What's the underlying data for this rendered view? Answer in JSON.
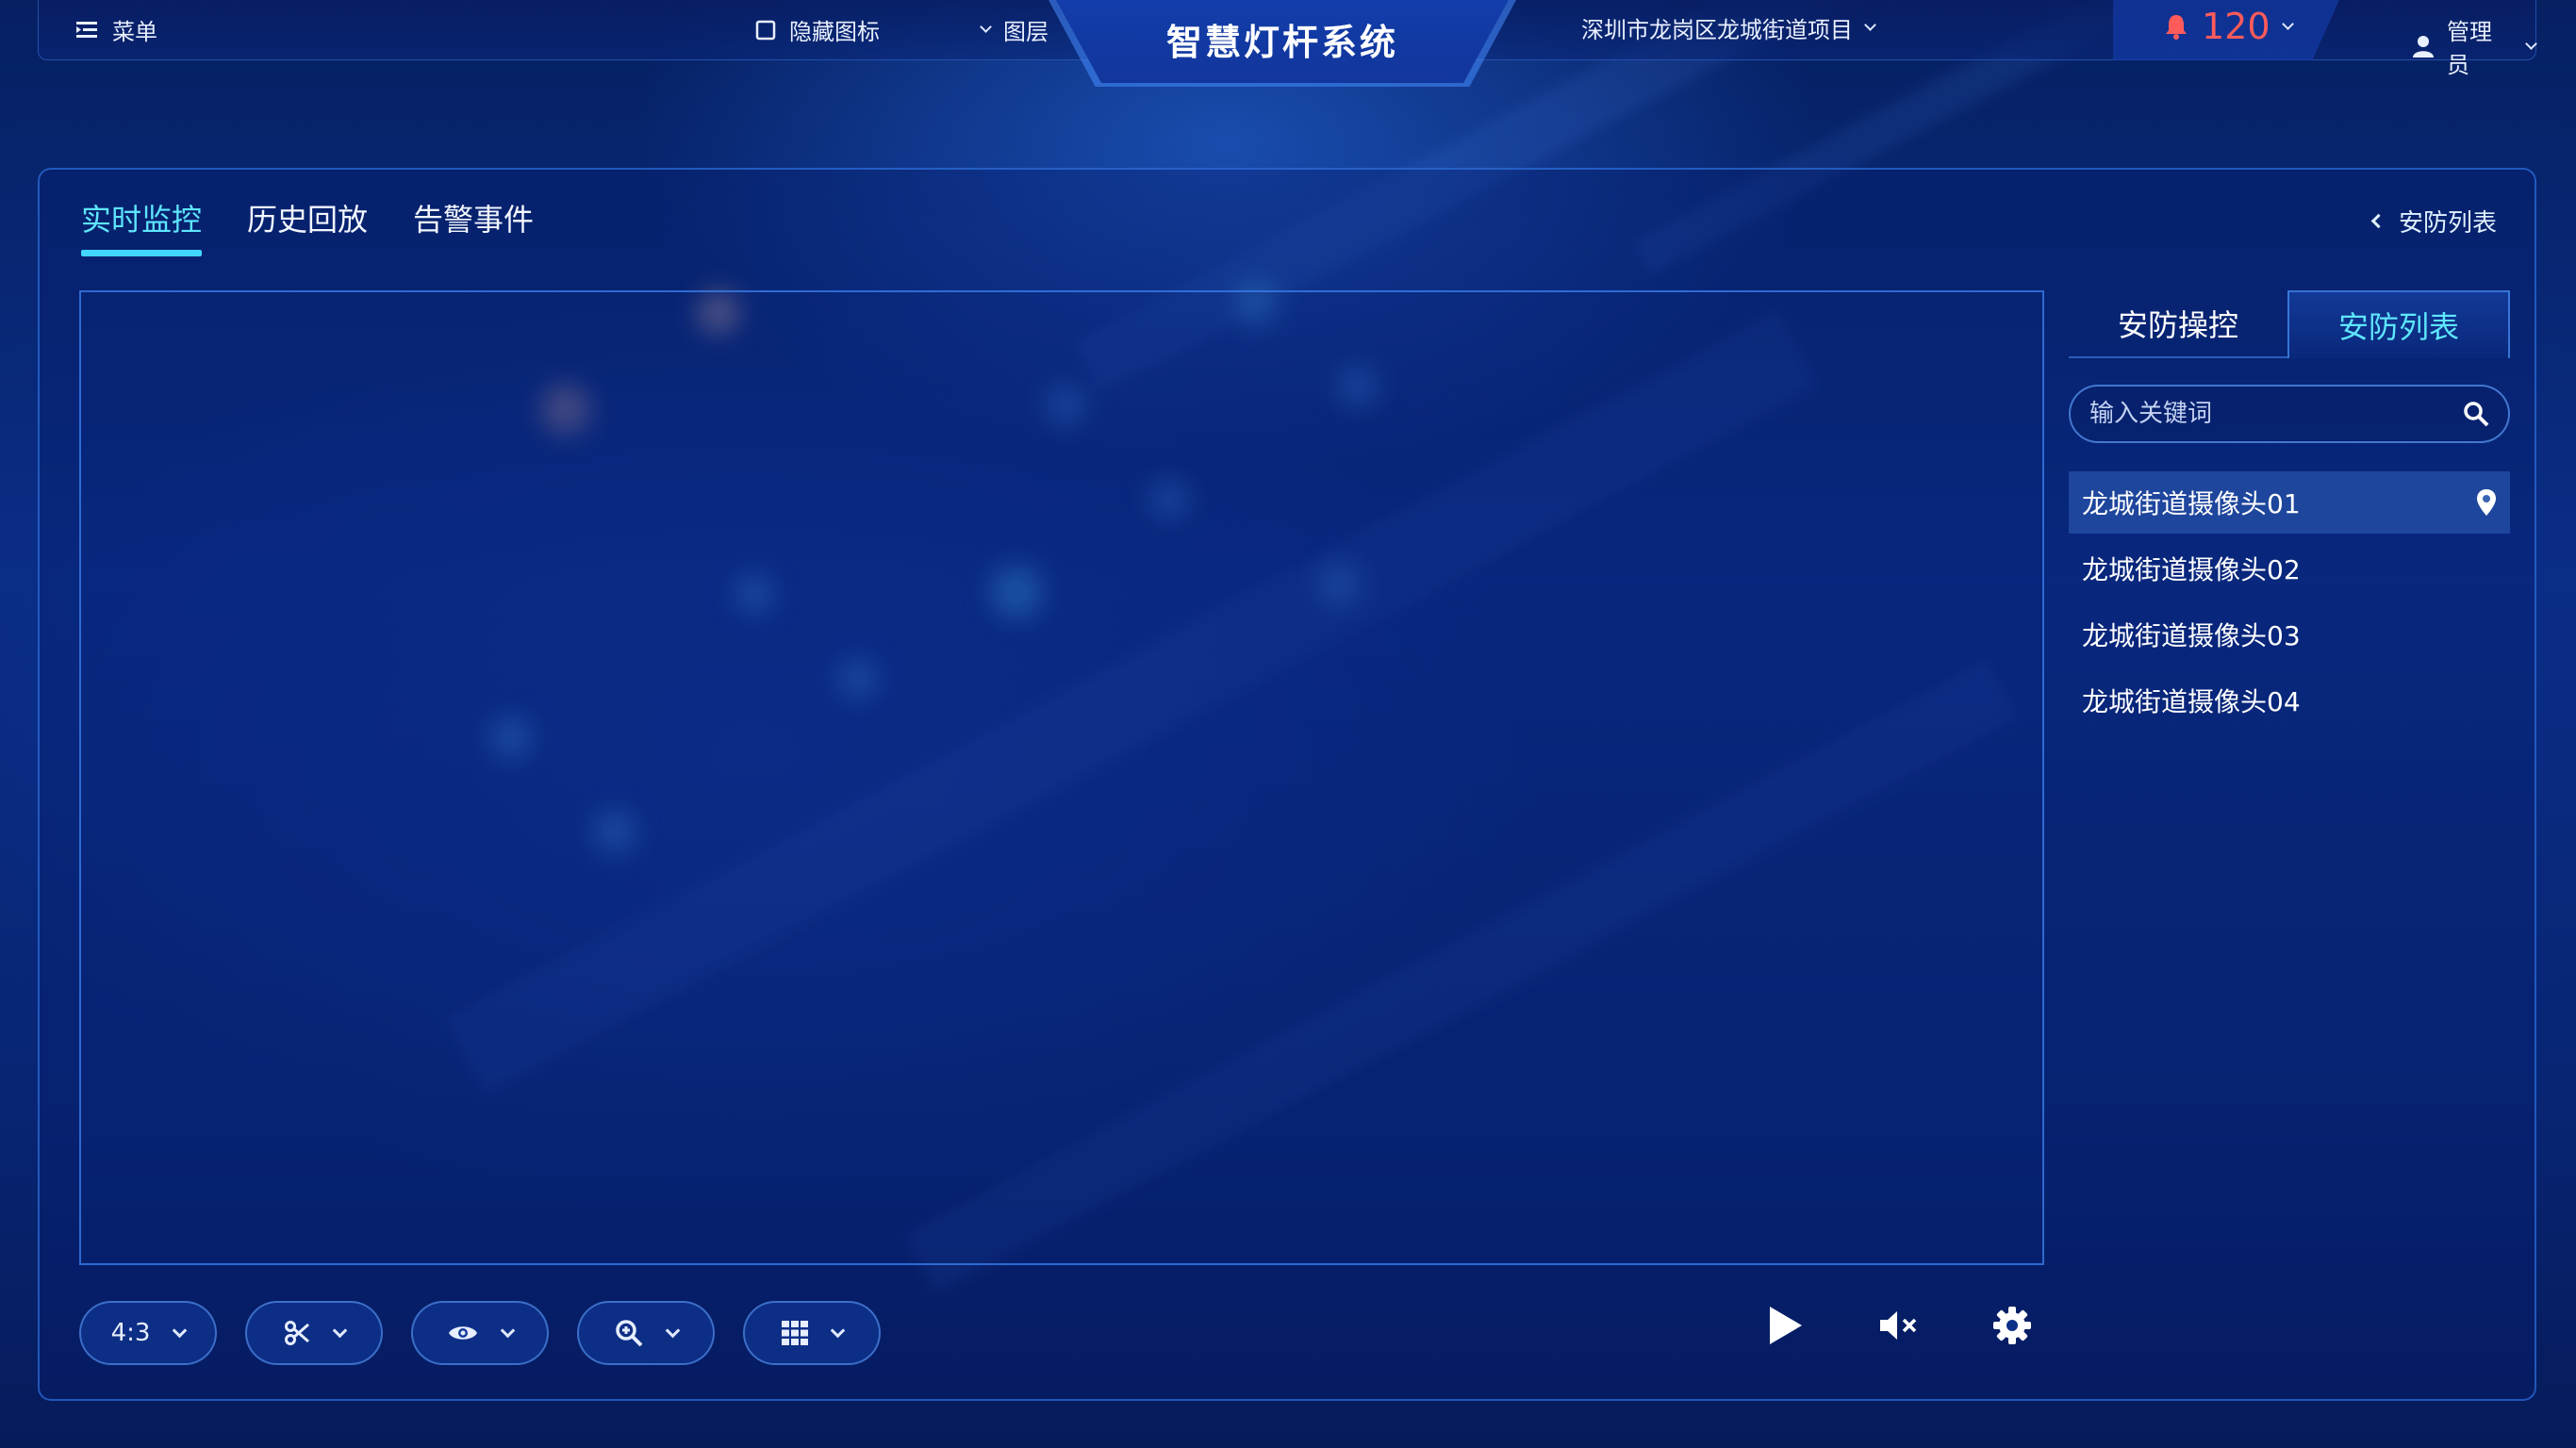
{
  "topbar": {
    "menu_label": "菜单",
    "hide_icons_label": "隐藏图标",
    "layers_label": "图层",
    "app_title": "智慧灯杆系统",
    "project_label": "深圳市龙岗区龙城街道项目",
    "alert_count": "120",
    "user_label": "管理员"
  },
  "main": {
    "tabs": [
      {
        "label": "实时监控",
        "active": true
      },
      {
        "label": "历史回放",
        "active": false
      },
      {
        "label": "告警事件",
        "active": false
      }
    ],
    "back_link_label": "安防列表"
  },
  "toolbar": {
    "aspect_ratio": "4:3",
    "tools": [
      "scissors-icon",
      "eye-icon",
      "zoom-in-icon",
      "grid-icon"
    ],
    "playback": [
      "play-icon",
      "mute-icon",
      "gear-icon"
    ]
  },
  "side": {
    "tabs": [
      {
        "label": "安防操控",
        "active": false
      },
      {
        "label": "安防列表",
        "active": true
      }
    ],
    "search_placeholder": "输入关键词",
    "cameras": [
      {
        "name": "龙城街道摄像头01",
        "selected": true
      },
      {
        "name": "龙城街道摄像头02",
        "selected": false
      },
      {
        "name": "龙城街道摄像头03",
        "selected": false
      },
      {
        "name": "龙城街道摄像头04",
        "selected": false
      }
    ]
  },
  "colors": {
    "accent": "#5ee6ff",
    "alert": "#ff5b5b",
    "background": "#0a2d86"
  }
}
